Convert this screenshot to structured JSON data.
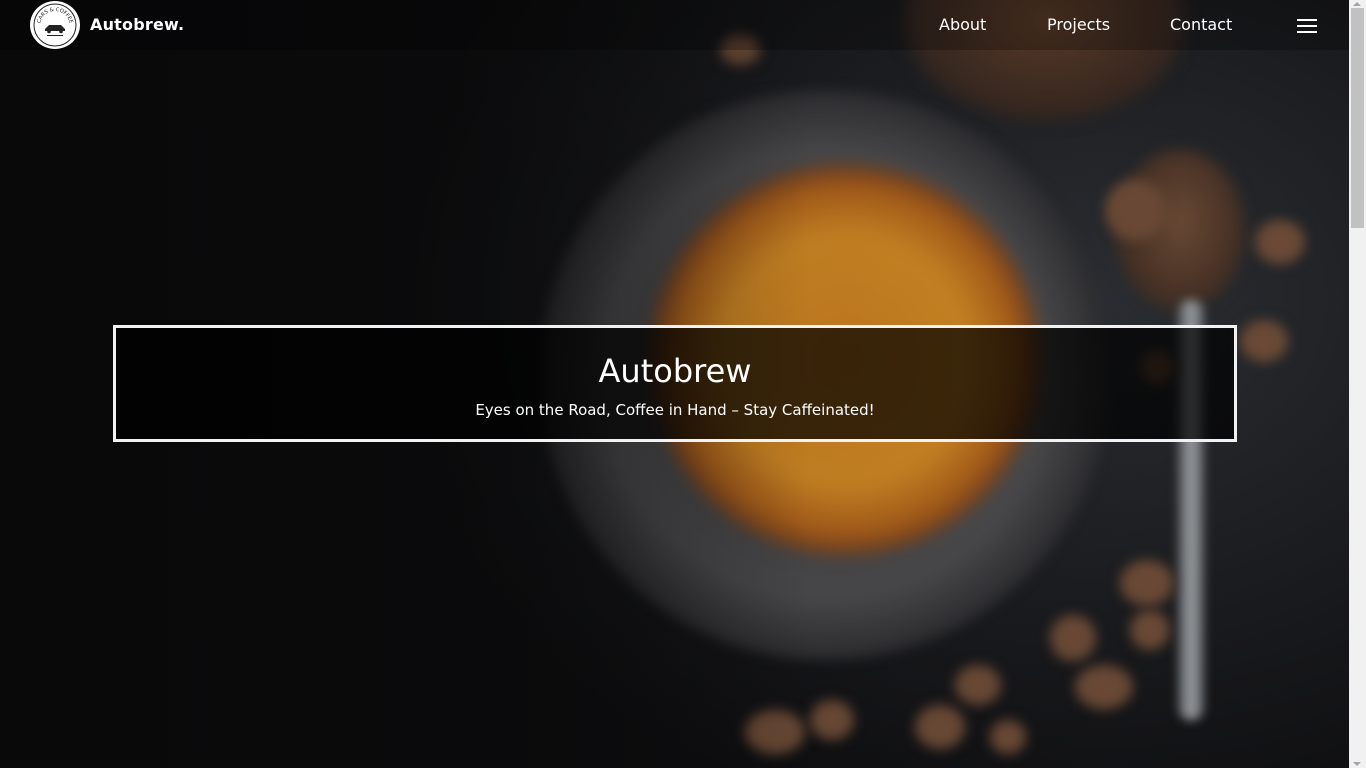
{
  "nav": {
    "brand": "Autobrew.",
    "logo_icon": "cars-and-coffee-logo-icon",
    "logo_text": "CARS & COFFEE",
    "items": [
      {
        "label": "About"
      },
      {
        "label": "Projects"
      },
      {
        "label": "Contact"
      }
    ],
    "menu_icon": "hamburger-menu-icon"
  },
  "hero": {
    "title": "Autobrew",
    "subtitle": "Eyes on the Road, Coffee in Hand – Stay Caffeinated!"
  },
  "colors": {
    "background": "#0c0c0d",
    "text": "#ffffff",
    "hero_border": "#f2f2f2",
    "coffee": "#c98423"
  }
}
